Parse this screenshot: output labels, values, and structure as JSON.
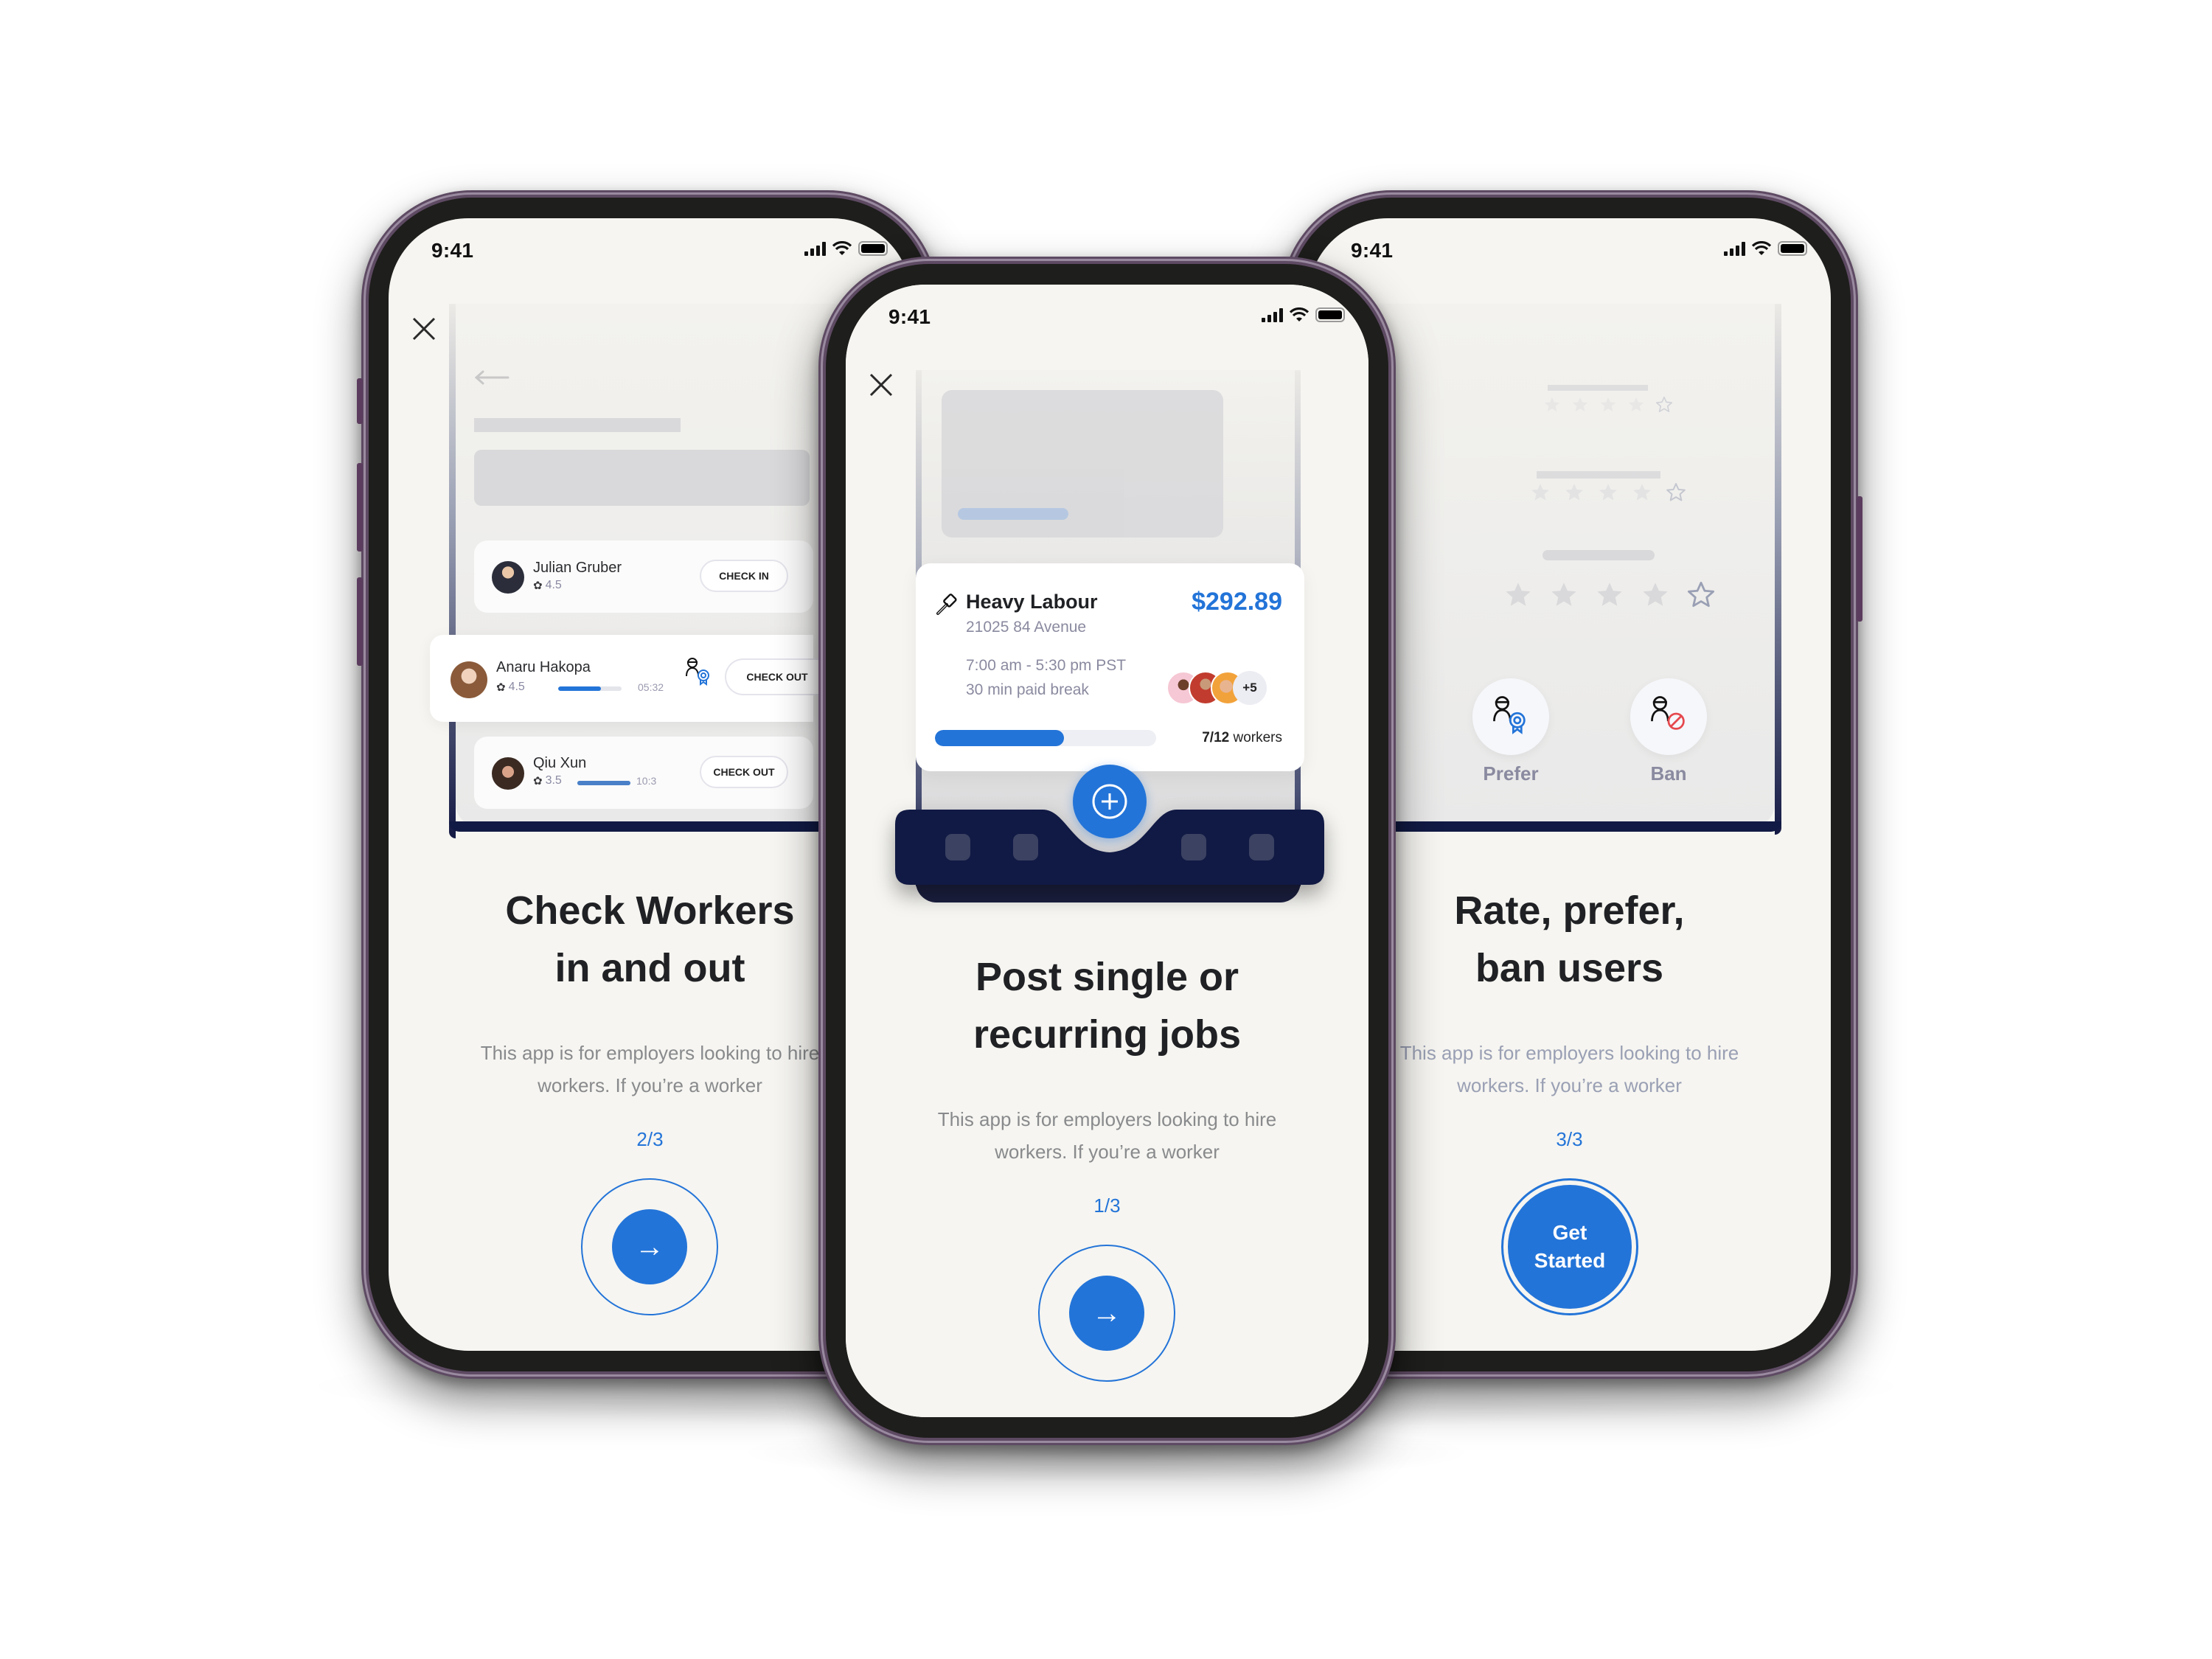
{
  "status_bar": {
    "time": "9:41"
  },
  "screens": {
    "left": {
      "title_line1": "Check Workers",
      "title_line2": "in and out",
      "desc_line1": "This app is for employers looking to hire",
      "desc_line2": "workers. If you’re a worker",
      "pager": "2/3",
      "next_icon": "→",
      "workers": [
        {
          "name": "Julian Gruber",
          "rating": "4.5",
          "action": "CHECK IN"
        },
        {
          "name": "Anaru Hakopa",
          "rating": "4.5",
          "progress_pct": 68,
          "time": "05:32",
          "action": "CHECK OUT",
          "badge": "preferred-worker"
        },
        {
          "name": "Qiu Xun",
          "rating": "3.5",
          "progress_pct": 100,
          "time": "10:3",
          "action": "CHECK OUT"
        }
      ]
    },
    "center": {
      "title_line1": "Post single or",
      "title_line2": "recurring jobs",
      "desc_line1": "This app is for employers looking to hire",
      "desc_line2": "workers. If you’re a worker",
      "pager": "1/3",
      "next_icon": "→",
      "job": {
        "title": "Heavy Labour",
        "price": "$292.89",
        "address": "21025 84 Avenue",
        "hours": "7:00 am - 5:30 pm PST",
        "break": "30 min paid break",
        "more_workers": "+5",
        "filled": "7/12",
        "filled_label": "workers",
        "filled_fraction": 0.583
      },
      "fab_icon": "+"
    },
    "right": {
      "title_line1": "Rate, prefer,",
      "title_line2": "ban users",
      "desc_line1": "This app is for employers looking to hire",
      "desc_line2": "workers. If you’re a worker",
      "pager": "3/3",
      "cta_line1": "Get",
      "cta_line2": "Started",
      "rating_value": 4,
      "rating_max": 5,
      "prefer_label": "Prefer",
      "ban_label": "Ban"
    }
  },
  "colors": {
    "accent": "#2374d8",
    "navy": "#111a44",
    "ban_red": "#e5484d",
    "frame": "#5e4a63"
  }
}
